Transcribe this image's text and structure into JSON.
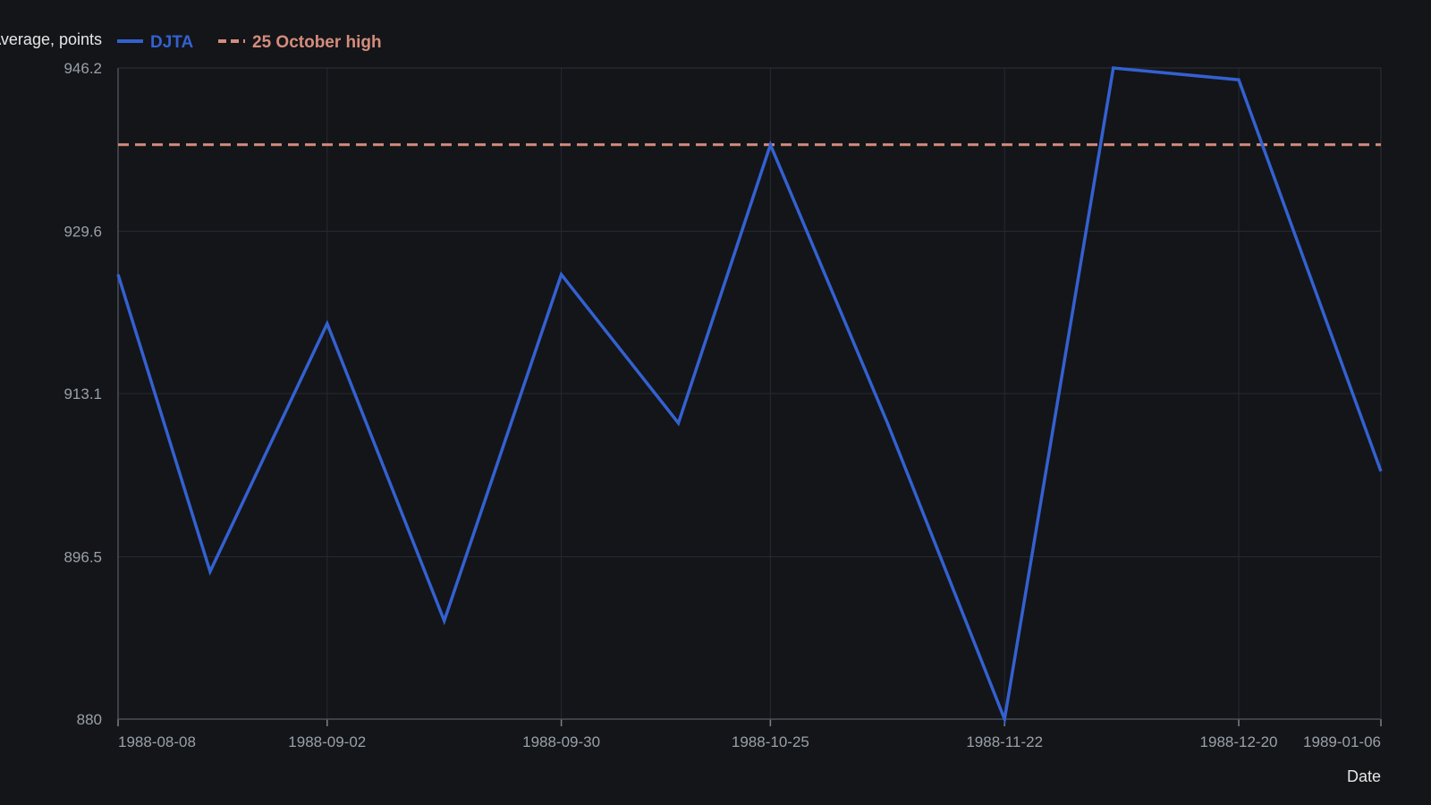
{
  "chart_data": {
    "type": "line",
    "ylabel": "Dow Jones Transportation Average, points",
    "xlabel": "Date",
    "ylim": [
      880,
      946.2
    ],
    "yticks": [
      "880",
      "896.5",
      "913.1",
      "929.6",
      "946.2"
    ],
    "xticks": [
      "1988-08-08",
      "1988-09-02",
      "1988-09-30",
      "1988-10-25",
      "1988-11-22",
      "1988-12-20",
      "1989-01-06"
    ],
    "grid": true,
    "legend_position": "top-left",
    "series": [
      {
        "name": "DJTA",
        "color": "#3461d1",
        "style": "solid",
        "x": [
          "1988-08-08",
          "1988-08-19",
          "1988-09-02",
          "1988-09-16",
          "1988-09-30",
          "1988-10-14",
          "1988-10-25",
          "1988-11-08",
          "1988-11-22",
          "1988-12-05",
          "1988-12-20",
          "1989-01-06"
        ],
        "y": [
          925.2,
          895.0,
          920.2,
          890.0,
          925.2,
          910.1,
          938.4,
          910.1,
          880.0,
          946.2,
          945.0,
          905.2
        ]
      },
      {
        "name": "25 October high",
        "color": "#d58c7c",
        "style": "dashed",
        "y": 938.4
      }
    ]
  }
}
